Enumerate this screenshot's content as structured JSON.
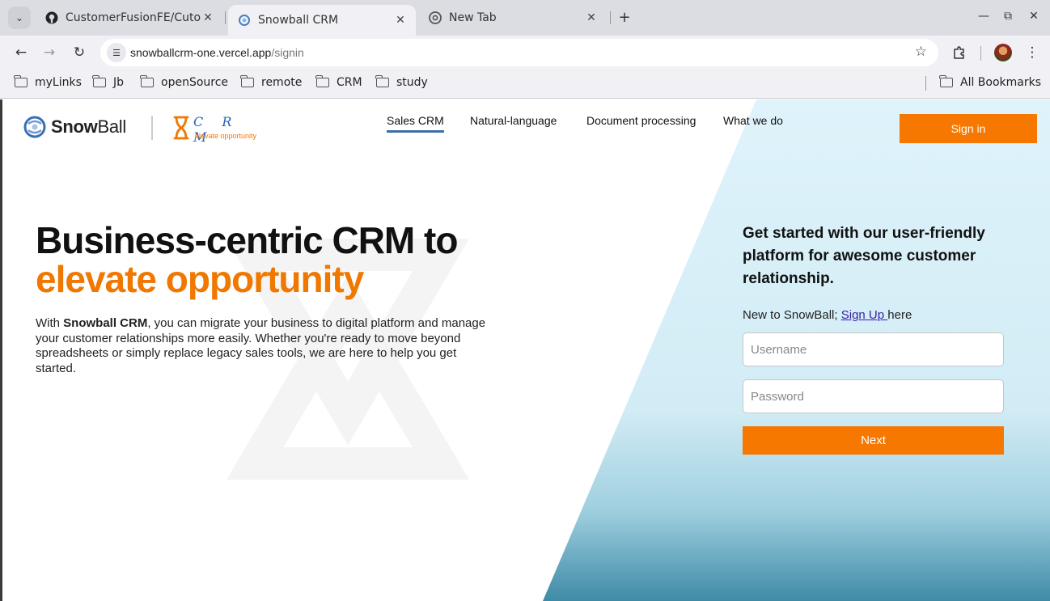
{
  "browser": {
    "tabs": [
      {
        "title": "CustomerFusionFE/Cuto",
        "icon": "github-icon"
      },
      {
        "title": "Snowball CRM",
        "icon": "snowball-favicon-icon",
        "active": true
      },
      {
        "title": "New Tab",
        "icon": "chrome-icon"
      }
    ],
    "url_host": "snowballcrm-one.vercel.app",
    "url_path": "/signin",
    "bookmarks": [
      "myLinks",
      "Jb",
      "openSource",
      "remote",
      "CRM",
      "study"
    ],
    "all_bookmarks": "All Bookmarks"
  },
  "header": {
    "logo_text_bold": "Snow",
    "logo_text_rest": "Ball",
    "crm_logo_letters": "C R M",
    "crm_logo_tagline": "elevate opportunity",
    "nav": [
      "Sales CRM",
      "Natural-language",
      "Document processing",
      "What we do"
    ],
    "signin_label": "Sign in"
  },
  "hero": {
    "title_line1": "Business-centric CRM to",
    "title_line2": "elevate opportunity",
    "desc_prefix": "With ",
    "desc_brand": "Snowball CRM",
    "desc_rest": ", you can migrate your business to digital platform and manage your customer relationships more easily. Whether you're ready to move beyond spreadsheets or simply replace legacy sales tools, we are here to help you get started."
  },
  "signin_panel": {
    "title": "Get started with our user-friendly platform for awesome customer relationship.",
    "new_prefix": "New to SnowBall; ",
    "signup_link": "Sign Up ",
    "new_suffix": "here",
    "username_placeholder": "Username",
    "password_placeholder": "Password",
    "next_label": "Next"
  },
  "colors": {
    "accent": "#f77800",
    "nav_underline": "#3e6da6",
    "panel_bg_top": "#dff3fb",
    "panel_bg_bottom": "#3f8ba6"
  }
}
